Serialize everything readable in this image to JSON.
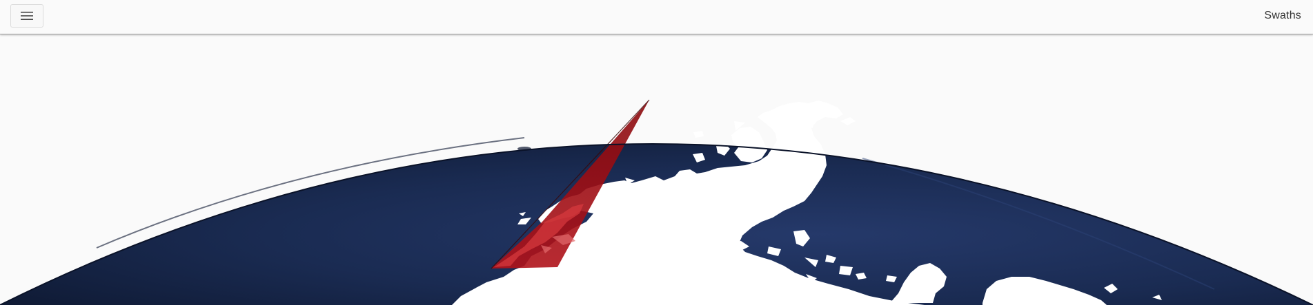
{
  "header": {
    "menu_icon": "hamburger-menu-icon",
    "title": "Swaths"
  },
  "map": {
    "view": "polar-globe",
    "ocean_color": "#16264a",
    "land_color": "#ffffff",
    "swath_color": "#a80c10"
  }
}
